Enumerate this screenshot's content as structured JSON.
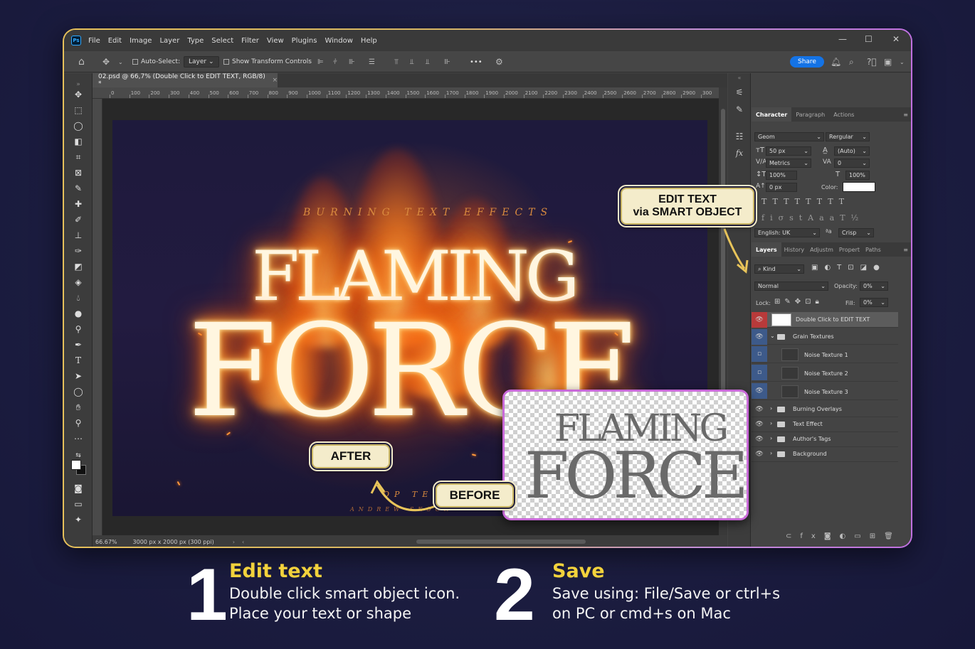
{
  "menubar": {
    "app_icon": "Ps",
    "items": [
      "File",
      "Edit",
      "Image",
      "Layer",
      "Type",
      "Select",
      "Filter",
      "View",
      "Plugins",
      "Window",
      "Help"
    ],
    "window_controls": [
      "—",
      "☐",
      "✕"
    ]
  },
  "options_bar": {
    "auto_select_label": "Auto-Select:",
    "auto_select_value": "Layer",
    "show_transform_label": "Show Transform Controls",
    "more": "•••",
    "share_label": "Share"
  },
  "document": {
    "tab_title": "02.psd @ 66,7% (Double Click to EDIT TEXT, RGB/8) *",
    "tab_close": "×",
    "ruler_h": [
      "0",
      "100",
      "200",
      "300",
      "400",
      "500",
      "600",
      "700",
      "800",
      "900",
      "1000",
      "1100",
      "1200",
      "1300",
      "1400",
      "1500",
      "1600",
      "1700",
      "1800",
      "1900",
      "2000",
      "2100",
      "2200",
      "2300",
      "2400",
      "2500",
      "2600",
      "2700",
      "2800",
      "2900",
      "300"
    ],
    "zoom": "66.67%",
    "doc_size": "3000 px x 2000 px (300 ppi)"
  },
  "artwork": {
    "subtitle_top": "BURNING TEXT EFFECTS",
    "word1": "FLAMING",
    "word2": "FORCE",
    "subtitle_bottom": "OP TEMPLATES",
    "author": "ANDREW SKOCH",
    "before_word1": "FLAMING",
    "before_word2": "FORCE"
  },
  "callouts": {
    "edit_line1": "EDIT TEXT",
    "edit_line2": "via SMART OBJECT",
    "after": "AFTER",
    "before": "BEFORE"
  },
  "character_panel": {
    "tabs": [
      "Character",
      "Paragraph",
      "Actions"
    ],
    "font_family": "Geom",
    "font_style": "Rergular",
    "size": "50 px",
    "leading": "(Auto)",
    "kerning": "Metrics",
    "tracking": "0",
    "vscale": "100%",
    "hscale": "100%",
    "baseline": "0 px",
    "color_label": "Color:",
    "language": "English: UK",
    "aa_label": "ªa",
    "antialias": "Crisp"
  },
  "layers_panel": {
    "tabs": [
      "Layers",
      "History",
      "Adjustm",
      "Propert",
      "Paths"
    ],
    "kind": "Kind",
    "blend_mode": "Normal",
    "opacity_label": "Opacity:",
    "opacity": "0%",
    "lock_label": "Lock:",
    "fill_label": "Fill:",
    "fill": "0%",
    "layers": [
      {
        "name": "Double Click to EDIT TEXT",
        "type": "smart-object"
      },
      {
        "name": "Grain Textures",
        "type": "group-open"
      },
      {
        "name": "Noise Texture 1",
        "type": "layer"
      },
      {
        "name": "Noise Texture 2",
        "type": "layer"
      },
      {
        "name": "Noise Texture 3",
        "type": "layer"
      },
      {
        "name": "Burning Overlays",
        "type": "group"
      },
      {
        "name": "Text Effect",
        "type": "group"
      },
      {
        "name": "Author's Tags",
        "type": "group"
      },
      {
        "name": "Background",
        "type": "group"
      }
    ]
  },
  "instructions": {
    "step1_number": "1",
    "step1_title": "Edit text",
    "step1_line1": "Double click smart object icon.",
    "step1_line2": "Place your text or shape",
    "step2_number": "2",
    "step2_title": "Save",
    "step2_line1": "Save using: File/Save or ctrl+s",
    "step2_line2": "on PC or cmd+s on Mac"
  },
  "colors": {
    "background": "#1c1d40",
    "accent_yellow": "#f2d23c",
    "frame_gold": "#e6c05a",
    "frame_purple": "#c070e0",
    "share_blue": "#1473e6",
    "selected_layer": "#5c5c5c"
  }
}
